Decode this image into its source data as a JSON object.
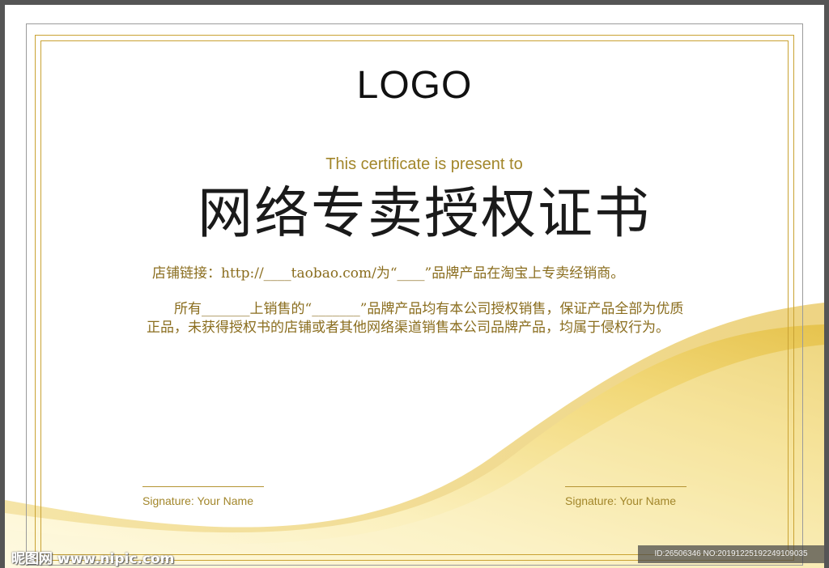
{
  "certificate": {
    "logo": "LOGO",
    "subtitle": "This certificate is present to",
    "title": "网络专卖授权证书",
    "store_line": "店铺链接：http://____taobao.com/为“____”品牌产品在淘宝上专卖经销商。",
    "authorization_paragraph": "所有_______上销售的“_______”品牌产品均有本公司授权销售，保证产品全部为优质正品，未获得授权书的店铺或者其他网络渠道销售本公司品牌产品，均属于侵权行为。",
    "signature_left": "Signature: Your Name",
    "signature_right": "Signature: Your Name"
  },
  "watermark": {
    "site": "昵图网 www.nipic.com",
    "id_text": "ID:26506346 NO:20191225192249109035"
  },
  "colors": {
    "gold": "#c9a233",
    "gold_text": "#8a6d1e",
    "wave_light": "#fbf3c4",
    "wave_dark": "#e9c75a"
  }
}
